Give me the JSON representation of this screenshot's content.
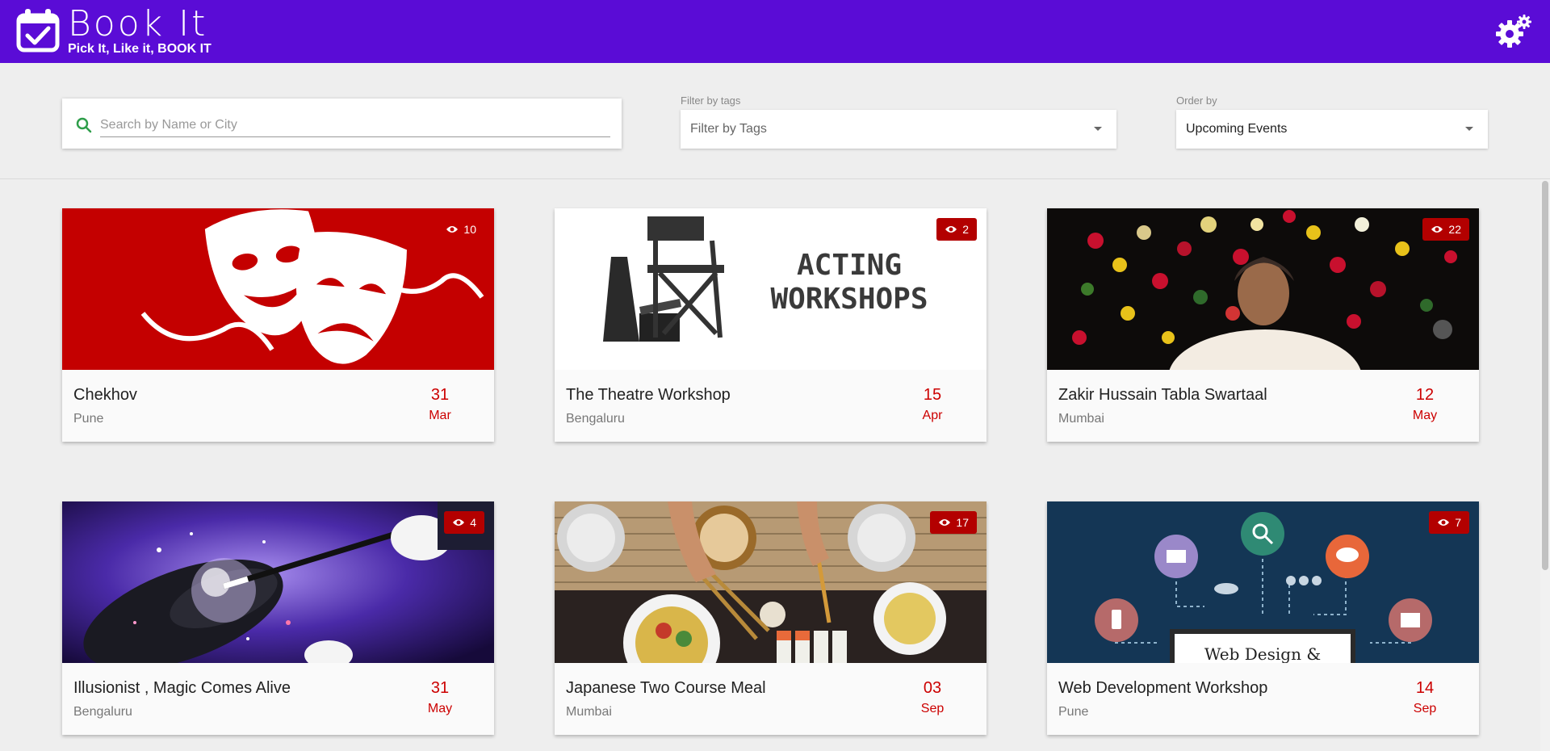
{
  "header": {
    "title": "Book It",
    "tagline": "Pick It, Like it, BOOK IT"
  },
  "search": {
    "placeholder": "Search by Name or City",
    "value": ""
  },
  "filters": {
    "tags_label": "Filter by tags",
    "tags_value": "Filter by Tags",
    "order_label": "Order by",
    "order_value": "Upcoming Events"
  },
  "colors": {
    "header": "#5a0cd6",
    "accent": "#c00000",
    "badge": "#b30000"
  },
  "events": [
    {
      "title": "Chekhov",
      "city": "Pune",
      "day": "31",
      "month": "Mar",
      "views": "10",
      "image": "theatre-masks"
    },
    {
      "title": "The Theatre Workshop",
      "city": "Bengaluru",
      "day": "15",
      "month": "Apr",
      "views": "2",
      "image": "acting-workshops",
      "image_text": [
        "ACTING",
        "WORKSHOPS"
      ]
    },
    {
      "title": "Zakir Hussain Tabla Swartaal",
      "city": "Mumbai",
      "day": "12",
      "month": "May",
      "views": "22",
      "image": "musician-flowers"
    },
    {
      "title": "Illusionist , Magic Comes Alive",
      "city": "Bengaluru",
      "day": "31",
      "month": "May",
      "views": "4",
      "image": "magic-hat"
    },
    {
      "title": "Japanese Two Course Meal",
      "city": "Mumbai",
      "day": "03",
      "month": "Sep",
      "views": "17",
      "image": "japanese-food"
    },
    {
      "title": "Web Development Workshop",
      "city": "Pune",
      "day": "14",
      "month": "Sep",
      "views": "7",
      "image": "web-design",
      "image_text": "Web Design &"
    }
  ]
}
